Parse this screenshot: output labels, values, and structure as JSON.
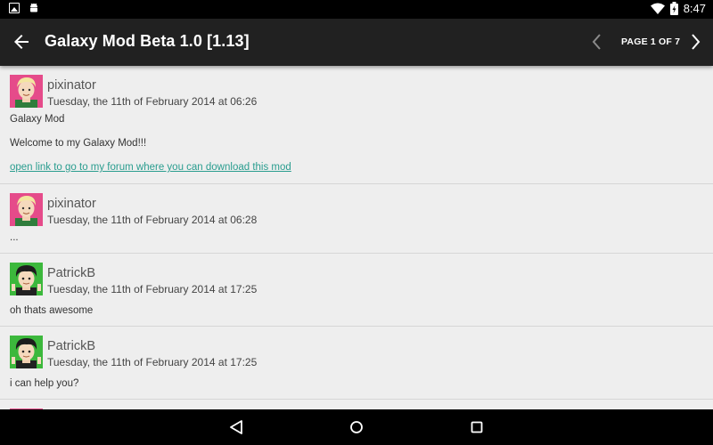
{
  "status_bar": {
    "time": "8:47",
    "battery_level_percent": 100,
    "left_icons": [
      "image-icon",
      "android-icon"
    ],
    "right_icons": [
      "wifi-icon",
      "battery-icon"
    ]
  },
  "toolbar": {
    "title": "Galaxy Mod Beta 1.0 [1.13]",
    "page_indicator": "PAGE 1 OF 7",
    "background_color": "#212121"
  },
  "posts": [
    {
      "username": "pixinator",
      "date": "Tuesday, the 11th of February 2014 at 06:26",
      "lines": [
        "Galaxy Mod",
        "Welcome to my Galaxy Mod!!!"
      ],
      "link": "open link to go to my forum where you can download this mod",
      "avatar": "blonde-avatar"
    },
    {
      "username": "pixinator",
      "date": "Tuesday, the 11th of February 2014 at 06:28",
      "lines": [
        "..."
      ],
      "avatar": "blonde-avatar"
    },
    {
      "username": "PatrickB",
      "date": "Tuesday, the 11th of February 2014 at 17:25",
      "lines": [
        "oh thats awesome"
      ],
      "avatar": "dark-hair-avatar"
    },
    {
      "username": "PatrickB",
      "date": "Tuesday, the 11th of February 2014 at 17:25",
      "lines": [
        "i can help you?"
      ],
      "avatar": "dark-hair-avatar"
    }
  ],
  "colors": {
    "link": "#2a9d8f",
    "background": "#eeeeee",
    "divider": "#d6d6d6"
  },
  "nav_bar": {
    "icons": [
      "back-triangle-icon",
      "home-circle-icon",
      "recents-square-icon"
    ]
  }
}
